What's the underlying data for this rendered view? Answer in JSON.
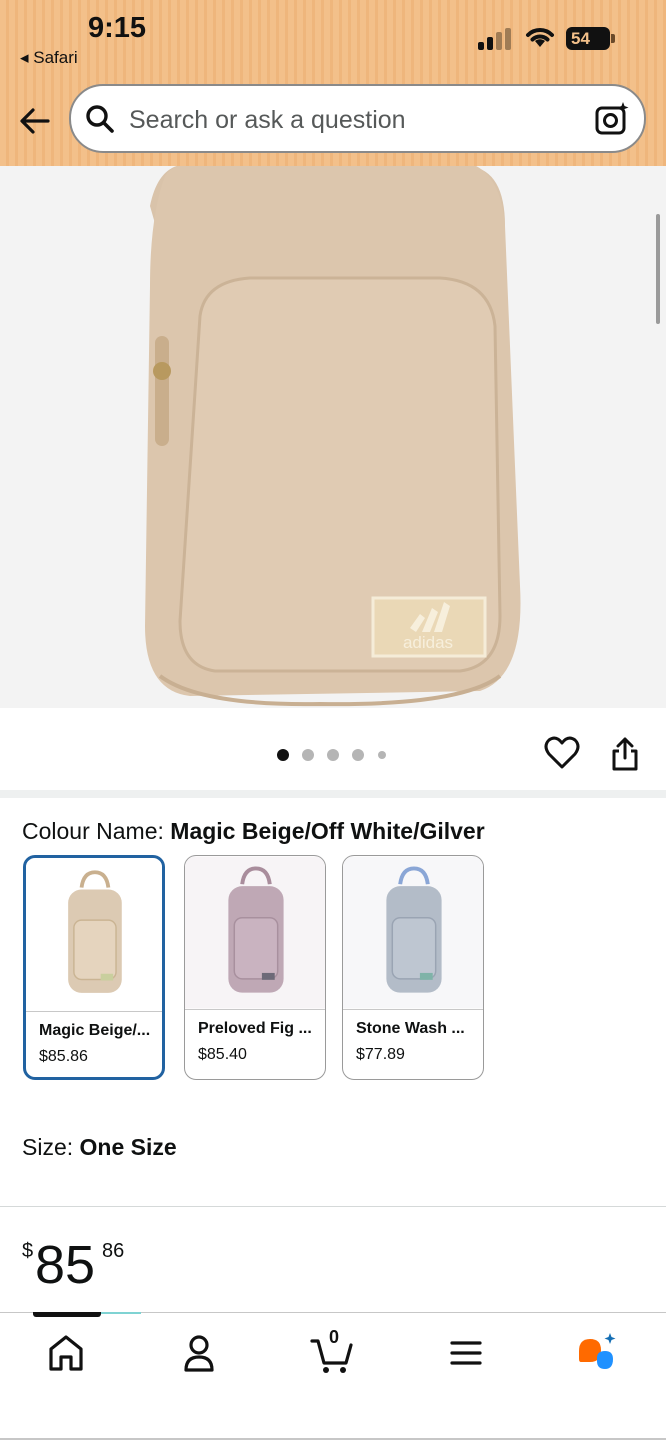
{
  "status_bar": {
    "time": "9:15",
    "back_app": "◂ Safari",
    "battery": "54"
  },
  "header": {
    "search_placeholder": "Search or ask a question",
    "back_icon": "back-arrow-icon",
    "camera_icon": "camera-lens-icon"
  },
  "product": {
    "image_page_count": 5,
    "image_page_active": 0,
    "colour_label": "Colour Name:",
    "colour_value": "Magic Beige/Off White/Gilver",
    "variants": [
      {
        "name": "Magic Beige/...",
        "price": "$85.86",
        "color": "#dccab3",
        "selected": true
      },
      {
        "name": "Preloved Fig ...",
        "price": "$85.40",
        "color": "#bfa8b5",
        "selected": false
      },
      {
        "name": "Stone Wash ...",
        "price": "$77.89",
        "color": "#b3bcc8",
        "selected": false
      }
    ],
    "size_label": "Size:",
    "size_value": "One Size",
    "price": {
      "currency": "$",
      "whole": "85",
      "fraction": "86"
    },
    "brand_badge": "adidas"
  },
  "bottom_nav": {
    "cart_count": "0",
    "items": [
      "home-icon",
      "account-icon",
      "cart-icon",
      "menu-icon",
      "rufus-ai-icon"
    ]
  },
  "colors": {
    "header_bg": "#f3c08a",
    "selected_border": "#2162a1",
    "text": "#0f1111"
  }
}
